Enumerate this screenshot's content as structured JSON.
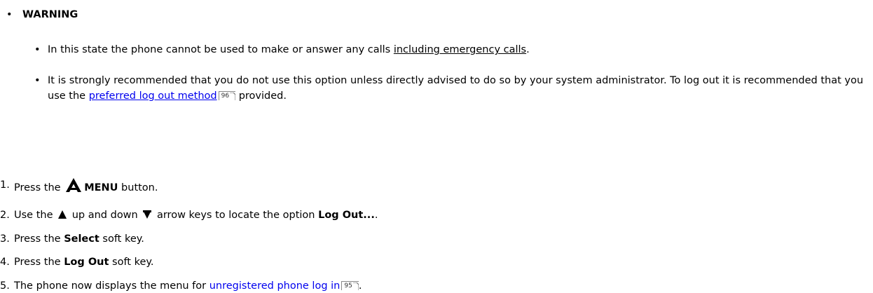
{
  "warning": {
    "bullet": "•",
    "title": "WARNING"
  },
  "items": [
    {
      "bullet": "•",
      "before": "In this state the phone cannot be used to make or answer any calls ",
      "underlined": "including emergency calls",
      "after": "."
    },
    {
      "bullet": "•",
      "before": "It is strongly recommended that you do not use this option unless directly advised to do so by your system administrator. To log out it is recommended that you use the ",
      "link": "preferred log out method",
      "ref": "96",
      "after": " provided."
    }
  ],
  "steps": [
    {
      "num": "1.",
      "pre": "Press the ",
      "bold": "MENU",
      "post": " button."
    },
    {
      "num": "2.",
      "pre": "Use the ",
      "mid": " up and down ",
      "post": " arrow keys to locate the option ",
      "bold": "Log Out...",
      "end": "."
    },
    {
      "num": "3.",
      "pre": "Press the ",
      "bold": "Select",
      "post": " soft key."
    },
    {
      "num": "4.",
      "pre": "Press the ",
      "bold": "Log Out",
      "post": " soft key."
    },
    {
      "num": "5.",
      "pre": "The phone now displays the menu for ",
      "link": "unregistered phone log in",
      "ref": "95",
      "post": "."
    }
  ],
  "colors": {
    "link": "#0000ee"
  },
  "icons": [
    "menu-icon",
    "up-arrow-icon",
    "down-arrow-icon",
    "page-ref-icon"
  ]
}
